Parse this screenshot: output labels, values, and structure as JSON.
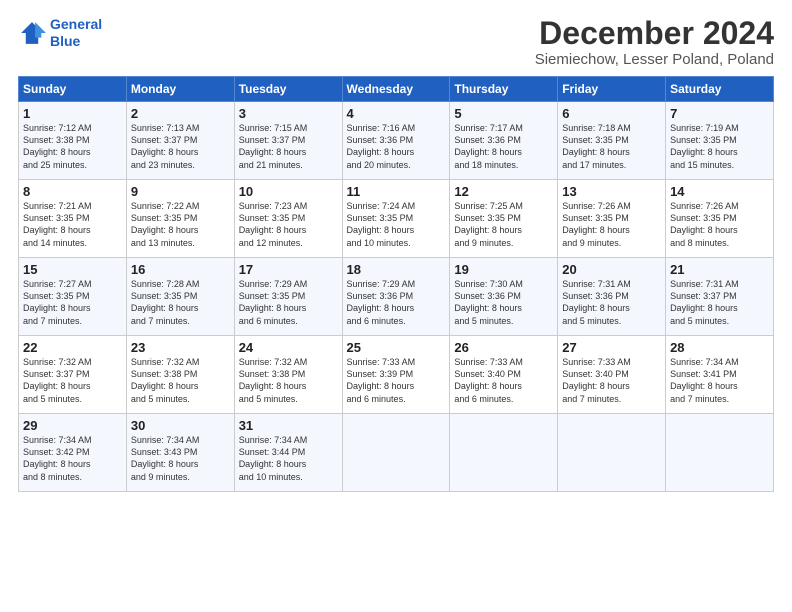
{
  "logo": {
    "line1": "General",
    "line2": "Blue"
  },
  "title": "December 2024",
  "subtitle": "Siemiechow, Lesser Poland, Poland",
  "days_header": [
    "Sunday",
    "Monday",
    "Tuesday",
    "Wednesday",
    "Thursday",
    "Friday",
    "Saturday"
  ],
  "weeks": [
    [
      {
        "num": "1",
        "lines": [
          "Sunrise: 7:12 AM",
          "Sunset: 3:38 PM",
          "Daylight: 8 hours",
          "and 25 minutes."
        ]
      },
      {
        "num": "2",
        "lines": [
          "Sunrise: 7:13 AM",
          "Sunset: 3:37 PM",
          "Daylight: 8 hours",
          "and 23 minutes."
        ]
      },
      {
        "num": "3",
        "lines": [
          "Sunrise: 7:15 AM",
          "Sunset: 3:37 PM",
          "Daylight: 8 hours",
          "and 21 minutes."
        ]
      },
      {
        "num": "4",
        "lines": [
          "Sunrise: 7:16 AM",
          "Sunset: 3:36 PM",
          "Daylight: 8 hours",
          "and 20 minutes."
        ]
      },
      {
        "num": "5",
        "lines": [
          "Sunrise: 7:17 AM",
          "Sunset: 3:36 PM",
          "Daylight: 8 hours",
          "and 18 minutes."
        ]
      },
      {
        "num": "6",
        "lines": [
          "Sunrise: 7:18 AM",
          "Sunset: 3:35 PM",
          "Daylight: 8 hours",
          "and 17 minutes."
        ]
      },
      {
        "num": "7",
        "lines": [
          "Sunrise: 7:19 AM",
          "Sunset: 3:35 PM",
          "Daylight: 8 hours",
          "and 15 minutes."
        ]
      }
    ],
    [
      {
        "num": "8",
        "lines": [
          "Sunrise: 7:21 AM",
          "Sunset: 3:35 PM",
          "Daylight: 8 hours",
          "and 14 minutes."
        ]
      },
      {
        "num": "9",
        "lines": [
          "Sunrise: 7:22 AM",
          "Sunset: 3:35 PM",
          "Daylight: 8 hours",
          "and 13 minutes."
        ]
      },
      {
        "num": "10",
        "lines": [
          "Sunrise: 7:23 AM",
          "Sunset: 3:35 PM",
          "Daylight: 8 hours",
          "and 12 minutes."
        ]
      },
      {
        "num": "11",
        "lines": [
          "Sunrise: 7:24 AM",
          "Sunset: 3:35 PM",
          "Daylight: 8 hours",
          "and 10 minutes."
        ]
      },
      {
        "num": "12",
        "lines": [
          "Sunrise: 7:25 AM",
          "Sunset: 3:35 PM",
          "Daylight: 8 hours",
          "and 9 minutes."
        ]
      },
      {
        "num": "13",
        "lines": [
          "Sunrise: 7:26 AM",
          "Sunset: 3:35 PM",
          "Daylight: 8 hours",
          "and 9 minutes."
        ]
      },
      {
        "num": "14",
        "lines": [
          "Sunrise: 7:26 AM",
          "Sunset: 3:35 PM",
          "Daylight: 8 hours",
          "and 8 minutes."
        ]
      }
    ],
    [
      {
        "num": "15",
        "lines": [
          "Sunrise: 7:27 AM",
          "Sunset: 3:35 PM",
          "Daylight: 8 hours",
          "and 7 minutes."
        ]
      },
      {
        "num": "16",
        "lines": [
          "Sunrise: 7:28 AM",
          "Sunset: 3:35 PM",
          "Daylight: 8 hours",
          "and 7 minutes."
        ]
      },
      {
        "num": "17",
        "lines": [
          "Sunrise: 7:29 AM",
          "Sunset: 3:35 PM",
          "Daylight: 8 hours",
          "and 6 minutes."
        ]
      },
      {
        "num": "18",
        "lines": [
          "Sunrise: 7:29 AM",
          "Sunset: 3:36 PM",
          "Daylight: 8 hours",
          "and 6 minutes."
        ]
      },
      {
        "num": "19",
        "lines": [
          "Sunrise: 7:30 AM",
          "Sunset: 3:36 PM",
          "Daylight: 8 hours",
          "and 5 minutes."
        ]
      },
      {
        "num": "20",
        "lines": [
          "Sunrise: 7:31 AM",
          "Sunset: 3:36 PM",
          "Daylight: 8 hours",
          "and 5 minutes."
        ]
      },
      {
        "num": "21",
        "lines": [
          "Sunrise: 7:31 AM",
          "Sunset: 3:37 PM",
          "Daylight: 8 hours",
          "and 5 minutes."
        ]
      }
    ],
    [
      {
        "num": "22",
        "lines": [
          "Sunrise: 7:32 AM",
          "Sunset: 3:37 PM",
          "Daylight: 8 hours",
          "and 5 minutes."
        ]
      },
      {
        "num": "23",
        "lines": [
          "Sunrise: 7:32 AM",
          "Sunset: 3:38 PM",
          "Daylight: 8 hours",
          "and 5 minutes."
        ]
      },
      {
        "num": "24",
        "lines": [
          "Sunrise: 7:32 AM",
          "Sunset: 3:38 PM",
          "Daylight: 8 hours",
          "and 5 minutes."
        ]
      },
      {
        "num": "25",
        "lines": [
          "Sunrise: 7:33 AM",
          "Sunset: 3:39 PM",
          "Daylight: 8 hours",
          "and 6 minutes."
        ]
      },
      {
        "num": "26",
        "lines": [
          "Sunrise: 7:33 AM",
          "Sunset: 3:40 PM",
          "Daylight: 8 hours",
          "and 6 minutes."
        ]
      },
      {
        "num": "27",
        "lines": [
          "Sunrise: 7:33 AM",
          "Sunset: 3:40 PM",
          "Daylight: 8 hours",
          "and 7 minutes."
        ]
      },
      {
        "num": "28",
        "lines": [
          "Sunrise: 7:34 AM",
          "Sunset: 3:41 PM",
          "Daylight: 8 hours",
          "and 7 minutes."
        ]
      }
    ],
    [
      {
        "num": "29",
        "lines": [
          "Sunrise: 7:34 AM",
          "Sunset: 3:42 PM",
          "Daylight: 8 hours",
          "and 8 minutes."
        ]
      },
      {
        "num": "30",
        "lines": [
          "Sunrise: 7:34 AM",
          "Sunset: 3:43 PM",
          "Daylight: 8 hours",
          "and 9 minutes."
        ]
      },
      {
        "num": "31",
        "lines": [
          "Sunrise: 7:34 AM",
          "Sunset: 3:44 PM",
          "Daylight: 8 hours",
          "and 10 minutes."
        ]
      },
      {
        "num": "",
        "lines": []
      },
      {
        "num": "",
        "lines": []
      },
      {
        "num": "",
        "lines": []
      },
      {
        "num": "",
        "lines": []
      }
    ]
  ]
}
